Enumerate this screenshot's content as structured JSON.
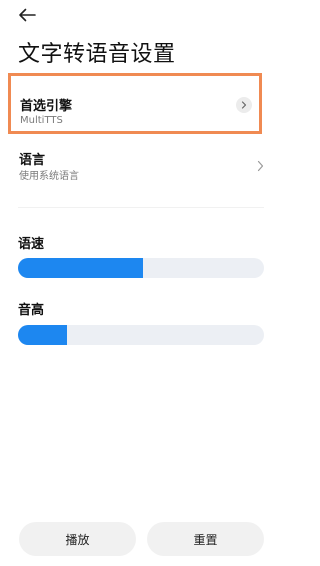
{
  "header": {
    "back_icon": "arrow-left-icon",
    "title": "文字转语音设置"
  },
  "preferred_engine": {
    "label": "首选引擎",
    "value": "MultiTTS",
    "chevron_icon": "chevron-right-icon",
    "highlight_color": "#f08a52"
  },
  "language": {
    "label": "语言",
    "value": "使用系统语言",
    "chevron_icon": "chevron-right-icon"
  },
  "speech_rate": {
    "label": "语速",
    "level_fraction": 0.51
  },
  "pitch": {
    "label": "音高",
    "level_fraction": 0.2
  },
  "actions": {
    "play_label": "播放",
    "reset_label": "重置"
  },
  "colors": {
    "accent": "#1d87f0",
    "track": "#eceff4",
    "button_bg": "#f1f1f1"
  }
}
